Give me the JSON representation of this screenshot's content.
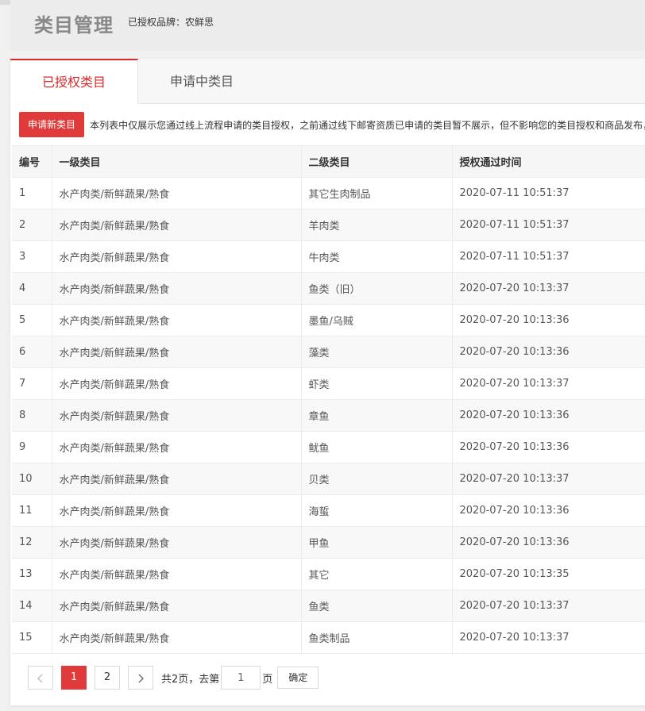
{
  "header": {
    "title": "类目管理",
    "brand_label": "已授权品牌：农鲜思"
  },
  "tabs": [
    {
      "label": "已授权类目",
      "active": true
    },
    {
      "label": "申请中类目",
      "active": false
    }
  ],
  "toolbar": {
    "apply_label": "申请新类目",
    "notice": "本列表中仅展示您通过线上流程申请的类目授权，之前通过线下邮寄资质已申请的类目暂不展示，但不影响您的类目授权和商品发布，"
  },
  "table": {
    "columns": [
      "编号",
      "一级类目",
      "二级类目",
      "授权通过时间"
    ],
    "rows": [
      [
        "1",
        "水产肉类/新鲜蔬果/熟食",
        "其它生肉制品",
        "2020-07-11 10:51:37"
      ],
      [
        "2",
        "水产肉类/新鲜蔬果/熟食",
        "羊肉类",
        "2020-07-11 10:51:37"
      ],
      [
        "3",
        "水产肉类/新鲜蔬果/熟食",
        "牛肉类",
        "2020-07-11 10:51:37"
      ],
      [
        "4",
        "水产肉类/新鲜蔬果/熟食",
        "鱼类（旧）",
        "2020-07-20 10:13:37"
      ],
      [
        "5",
        "水产肉类/新鲜蔬果/熟食",
        "墨鱼/乌贼",
        "2020-07-20 10:13:36"
      ],
      [
        "6",
        "水产肉类/新鲜蔬果/熟食",
        "藻类",
        "2020-07-20 10:13:36"
      ],
      [
        "7",
        "水产肉类/新鲜蔬果/熟食",
        "虾类",
        "2020-07-20 10:13:37"
      ],
      [
        "8",
        "水产肉类/新鲜蔬果/熟食",
        "章鱼",
        "2020-07-20 10:13:36"
      ],
      [
        "9",
        "水产肉类/新鲜蔬果/熟食",
        "鱿鱼",
        "2020-07-20 10:13:36"
      ],
      [
        "10",
        "水产肉类/新鲜蔬果/熟食",
        "贝类",
        "2020-07-20 10:13:37"
      ],
      [
        "11",
        "水产肉类/新鲜蔬果/熟食",
        "海蜇",
        "2020-07-20 10:13:36"
      ],
      [
        "12",
        "水产肉类/新鲜蔬果/熟食",
        "甲鱼",
        "2020-07-20 10:13:36"
      ],
      [
        "13",
        "水产肉类/新鲜蔬果/熟食",
        "其它",
        "2020-07-20 10:13:35"
      ],
      [
        "14",
        "水产肉类/新鲜蔬果/熟食",
        "鱼类",
        "2020-07-20 10:13:37"
      ],
      [
        "15",
        "水产肉类/新鲜蔬果/熟食",
        "鱼类制品",
        "2020-07-20 10:13:37"
      ]
    ]
  },
  "pagination": {
    "pages": [
      "1",
      "2"
    ],
    "current": "1",
    "total_text": "共2页，去第",
    "input_value": "1",
    "page_suffix": "页",
    "confirm_label": "确定",
    "prev_icon": "chevron-left-icon",
    "next_icon": "chevron-right-icon"
  },
  "colors": {
    "accent": "#e03a3a",
    "tab_active": "#d62b2b"
  }
}
